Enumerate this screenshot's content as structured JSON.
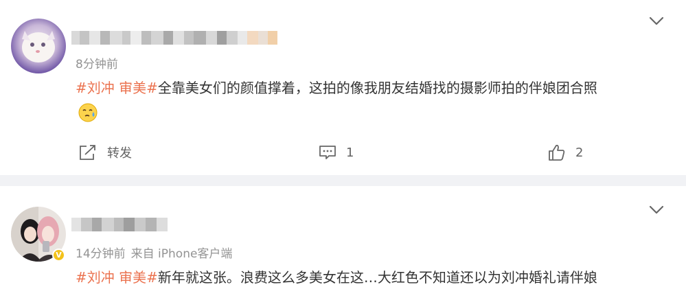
{
  "posts": [
    {
      "time": "8分钟前",
      "source": "",
      "hashtag": "#刘冲 审美#",
      "content": "全靠美女们的颜值撑着，这拍的像我朋友结婚找的摄影师拍的伴娘团合照",
      "emoji": "sweat-face-icon",
      "actions": {
        "share_label": "转发",
        "comment_count": "1",
        "like_count": "2"
      }
    },
    {
      "time": "14分钟前",
      "source": "来自 iPhone客户端",
      "hashtag": "#刘冲 审美#",
      "content": "新年就这张。浪费这么多美女在这…大红色不知道还以为刘冲婚礼请伴娘",
      "verified_badge": "V"
    }
  ],
  "colors": {
    "hashtag": "#eb7350",
    "meta": "#939393",
    "separator": "#f1f2f5",
    "verified": "#f3c21b"
  }
}
